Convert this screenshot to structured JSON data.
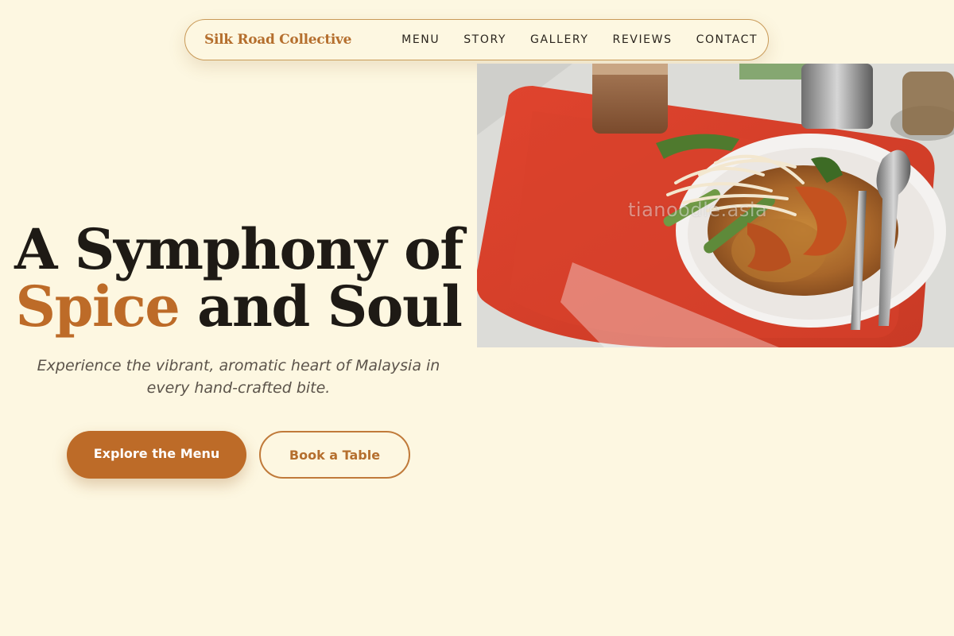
{
  "nav": {
    "brand": "Silk Road Collective",
    "links": [
      "MENU",
      "STORY",
      "GALLERY",
      "REVIEWS",
      "CONTACT"
    ]
  },
  "hero": {
    "title_line1": "A Symphony of",
    "title_accent": "Spice",
    "title_line2_rest": " and Soul",
    "subtitle": "Experience the vibrant, aromatic heart of Malaysia in every hand-crafted bite.",
    "primary_button": "Explore the Menu",
    "secondary_button": "Book a Table"
  },
  "image": {
    "subject": "plate of noodles with prawns and bean sprouts on a red tray",
    "watermark": "tianoodle.asia"
  },
  "colors": {
    "background": "#fdf7e1",
    "accent": "#bd6b28",
    "heading": "#1e1a15",
    "subtitle": "#5b534a",
    "border": "#c99a58"
  }
}
